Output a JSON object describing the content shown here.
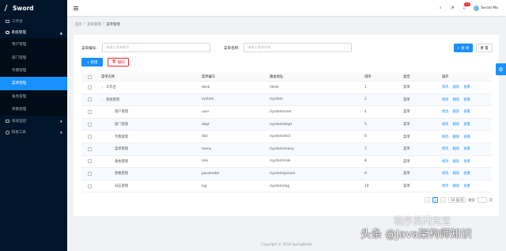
{
  "app": {
    "name": "Sword"
  },
  "sidebar": {
    "items": [
      {
        "label": "工作台",
        "icon": "monitor-icon"
      },
      {
        "label": "系统管理",
        "icon": "gear-icon",
        "expanded": true
      },
      {
        "label": "系统监控",
        "icon": "monitor-icon"
      },
      {
        "label": "研发工具",
        "icon": "tool-icon"
      }
    ],
    "system_children": [
      "用户管理",
      "部门管理",
      "字典管理",
      "菜单管理",
      "角色管理",
      "参数管理"
    ],
    "active": "菜单管理"
  },
  "header": {
    "notification_count": "11",
    "user_name": "Serati Ma"
  },
  "breadcrumb": [
    "首页",
    "/",
    "系统管理",
    "/",
    "菜单管理"
  ],
  "search": {
    "code_label": "菜单编号:",
    "code_placeholder": "请输入菜单编号",
    "name_label": "菜单名称:",
    "name_placeholder": "请输入菜单名称",
    "search_button": "查 询",
    "reset_button": "重 置"
  },
  "toolbar": {
    "add_button": "+ 新增",
    "delete_button": "删除"
  },
  "table": {
    "headers": [
      "菜单名称",
      "菜单编号",
      "路由地址",
      "排序",
      "类型",
      "操作"
    ],
    "rows": [
      {
        "name": "工作台",
        "code": "desk",
        "path": "/desk",
        "sort": "1",
        "type": "菜单",
        "toggle": "+",
        "indent": 1
      },
      {
        "name": "系统管理",
        "code": "system",
        "path": "/system",
        "sort": "2",
        "type": "菜单",
        "toggle": "−",
        "indent": 1
      },
      {
        "name": "用户管理",
        "code": "user",
        "path": "/system/user",
        "sort": "4",
        "type": "菜单",
        "toggle": "",
        "indent": 2
      },
      {
        "name": "部门管理",
        "code": "dept",
        "path": "/system/dept",
        "sort": "5",
        "type": "菜单",
        "toggle": "",
        "indent": 2
      },
      {
        "name": "字典管理",
        "code": "dict",
        "path": "/system/dict",
        "sort": "6",
        "type": "菜单",
        "toggle": "",
        "indent": 2
      },
      {
        "name": "菜单管理",
        "code": "menu",
        "path": "/system/menu",
        "sort": "7",
        "type": "菜单",
        "toggle": "",
        "indent": 2
      },
      {
        "name": "角色管理",
        "code": "role",
        "path": "/system/role",
        "sort": "8",
        "type": "菜单",
        "toggle": "",
        "indent": 2
      },
      {
        "name": "参数管理",
        "code": "parameter",
        "path": "/system/param",
        "sort": "9",
        "type": "菜单",
        "toggle": "",
        "indent": 2
      },
      {
        "name": "日志管理",
        "code": "log",
        "path": "/system/log",
        "sort": "10",
        "type": "菜单",
        "toggle": "",
        "indent": 2
      }
    ],
    "ops": [
      "修改",
      "删除",
      "查看"
    ]
  },
  "pagination": {
    "prev": "‹",
    "current": "1",
    "next": "›",
    "page_size": "10 条/页",
    "jump_label": "跳至",
    "jump_suffix": "页"
  },
  "footer": "Copyright © 2018 SpringBlade",
  "watermark": {
    "line1": "程序员闪充宝",
    "line2": "头条 @Java架构师知识"
  },
  "colors": {
    "primary": "#1890ff",
    "sidebar": "#001529",
    "danger": "#f5222d"
  }
}
